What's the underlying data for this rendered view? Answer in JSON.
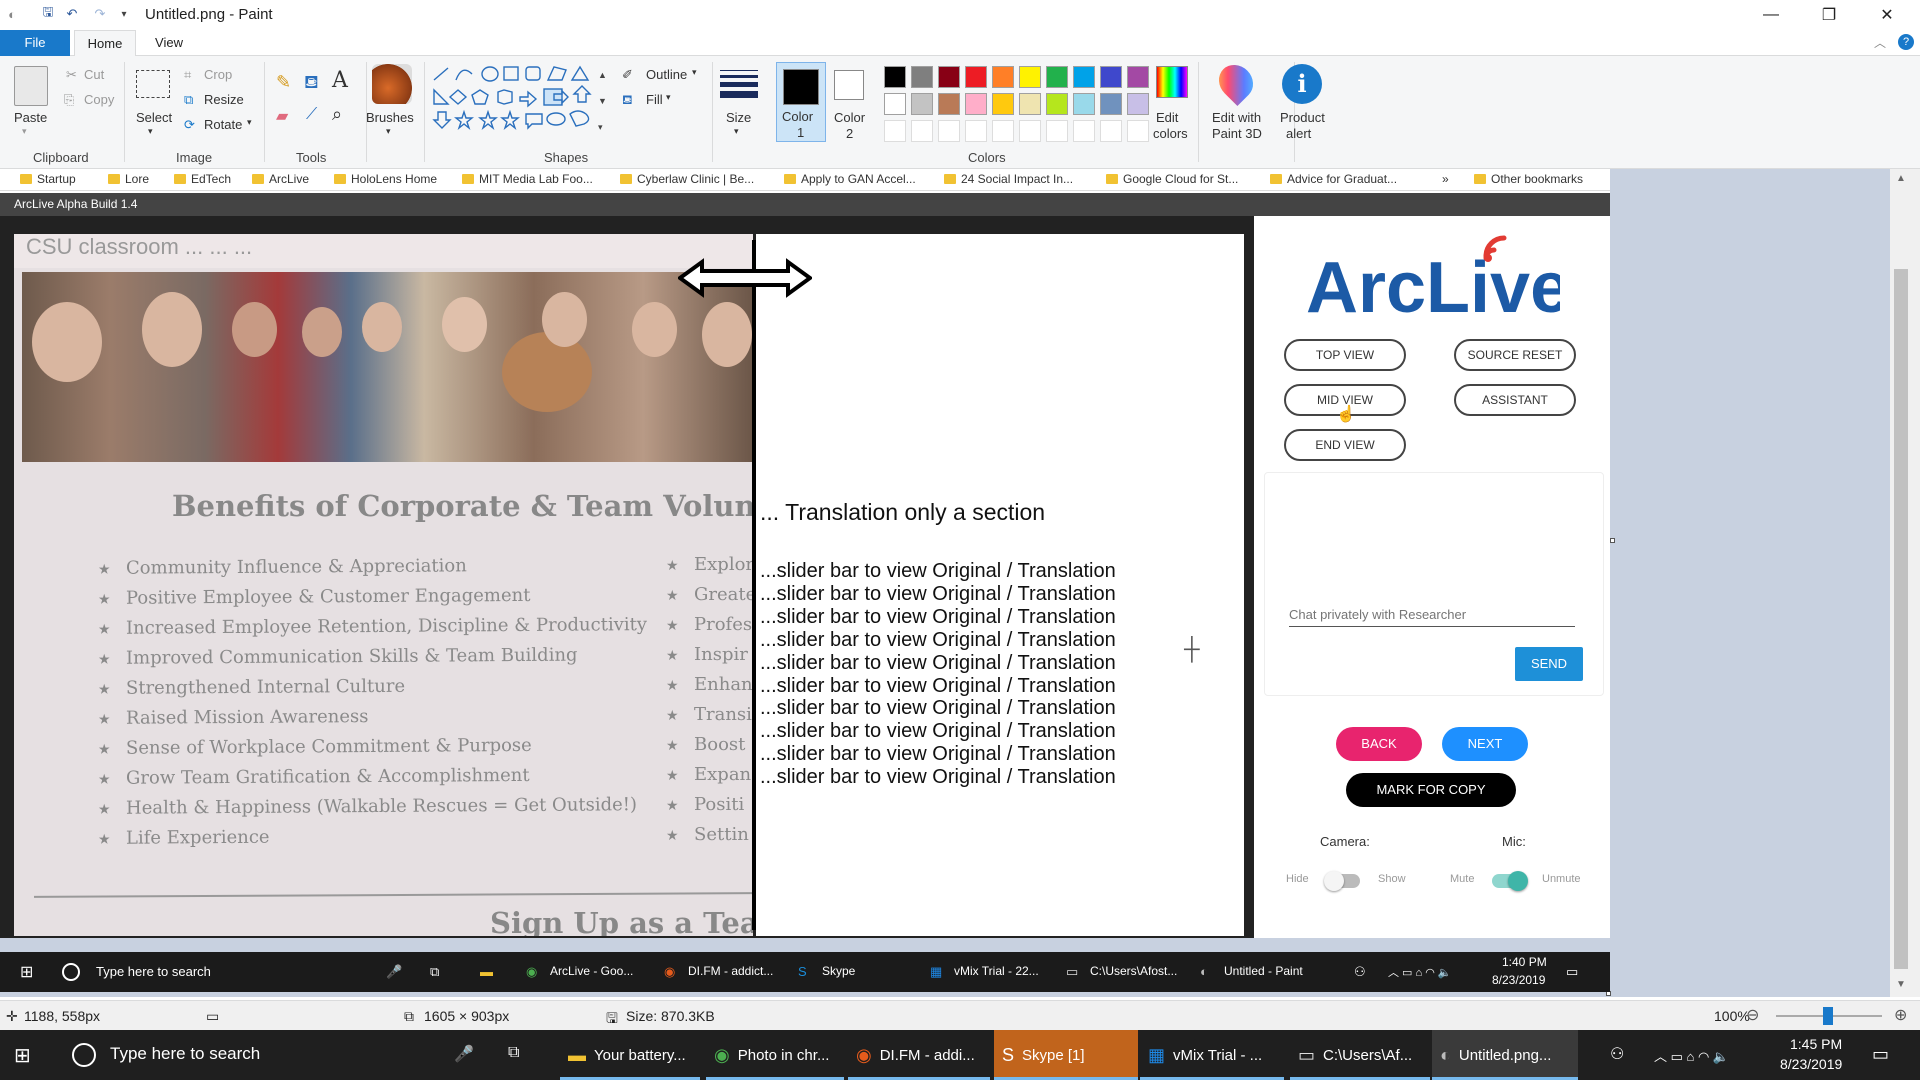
{
  "window": {
    "title": "Untitled.png - Paint"
  },
  "ribbon_tabs": {
    "file": "File",
    "home": "Home",
    "view": "View"
  },
  "ribbon": {
    "clipboard": {
      "paste": "Paste",
      "cut": "Cut",
      "copy": "Copy",
      "label": "Clipboard"
    },
    "image": {
      "select": "Select",
      "crop": "Crop",
      "resize": "Resize",
      "rotate": "Rotate",
      "label": "Image"
    },
    "tools": {
      "label": "Tools"
    },
    "brushes": "Brushes",
    "shapes": {
      "outline": "Outline",
      "fill": "Fill",
      "label": "Shapes"
    },
    "size": "Size",
    "color1": {
      "name": "Color",
      "num": "1"
    },
    "color2": {
      "name": "Color",
      "num": "2"
    },
    "colors_label": "Colors",
    "edit_colors": [
      "Edit",
      "colors"
    ],
    "edit_paint3d": [
      "Edit with",
      "Paint 3D"
    ],
    "product_alert": [
      "Product",
      "alert"
    ],
    "palette_row1": [
      "#000000",
      "#7f7f7f",
      "#880015",
      "#ed1c24",
      "#ff7f27",
      "#fff200",
      "#22b14c",
      "#00a2e8",
      "#3f48cc",
      "#a349a4"
    ],
    "palette_row2": [
      "#ffffff",
      "#c3c3c3",
      "#b97a57",
      "#ffaec9",
      "#ffc90e",
      "#efe4b0",
      "#b5e61d",
      "#99d9ea",
      "#7092be",
      "#c8bfe7"
    ]
  },
  "bookmarks": [
    "Startup",
    "Lore",
    "EdTech",
    "ArcLive",
    "HoloLens Home",
    "MIT Media Lab Foo...",
    "Cyberlaw Clinic | Be...",
    "Apply to GAN Accel...",
    "24 Social Impact In...",
    "Google Cloud for St...",
    "Advice for Graduat...",
    "»",
    "Other bookmarks"
  ],
  "app": {
    "build": "ArcLive Alpha Build 1.4",
    "photo_header": "CSU classroom ... ... ...",
    "benefits_title": "Benefits of Corporate & Team Volun",
    "benefits": [
      "Community Influence & Appreciation",
      "Positive Employee & Customer Engagement",
      "Increased Employee Retention, Discipline & Productivity",
      "Improved Communication Skills & Team Building",
      "Strengthened Internal Culture",
      "Raised Mission Awareness",
      "Sense of Workplace Commitment & Purpose",
      "Grow Team Gratification & Accomplishment",
      "Health & Happiness (Walkable Rescues = Get Outside!)",
      "Life Experience"
    ],
    "right_col": [
      "Explor",
      "Greate",
      "Profes",
      "Inspir",
      "Enhan",
      "Transi",
      "Boost",
      "Expan",
      "Positi",
      "Settin"
    ],
    "signup": "Sign Up as a Tea",
    "translation_heading": "... Translation only a section",
    "translation_rows": [
      "...slider bar to view Original / Translation",
      "...slider bar to view Original / Translation",
      "...slider bar to view Original / Translation",
      "...slider bar to view Original / Translation",
      "...slider bar to view Original / Translation",
      "...slider bar to view Original / Translation",
      "...slider bar to view Original / Translation",
      "...slider bar to view Original / Translation",
      "...slider bar to view Original / Translation",
      "...slider bar to view Original / Translation"
    ],
    "logo_text": "ArcLive",
    "buttons": {
      "top_view": "TOP VIEW",
      "source_reset": "SOURCE RESET",
      "mid_view": "MID VIEW",
      "assistant": "ASSISTANT",
      "end_view": "END VIEW",
      "send": "SEND",
      "back": "BACK",
      "next": "NEXT",
      "mark_for_copy": "MARK FOR COPY"
    },
    "chat_placeholder": "Chat privately with Researcher",
    "camera": {
      "label": "Camera:",
      "hide": "Hide",
      "show": "Show",
      "on": false
    },
    "mic": {
      "label": "Mic:",
      "mute": "Mute",
      "unmute": "Unmute",
      "on": true
    },
    "colors": {
      "back": "#e8246e",
      "next": "#1e90ff",
      "send": "#1e90d8",
      "logo": "#1c5aa6",
      "signal": "#e23b33",
      "toggle_on": "#3fb5a8"
    }
  },
  "inner_taskbar": {
    "search": "Type here to search",
    "apps": [
      "ArcLive - Goo...",
      "DI.FM - addict...",
      "Skype",
      "vMix Trial - 22...",
      "C:\\Users\\Afost...",
      "Untitled - Paint"
    ],
    "time": "1:40 PM",
    "date": "8/23/2019"
  },
  "statusbar": {
    "cursor": "1188, 558px",
    "dimensions": "1605 × 903px",
    "size": "Size: 870.3KB",
    "zoom": "100%"
  },
  "taskbar": {
    "search": "Type here to search",
    "apps": [
      "Your battery...",
      "Photo in chr...",
      "DI.FM - addi...",
      "Skype [1]",
      "vMix Trial - ...",
      "C:\\Users\\Af...",
      "Untitled.png..."
    ],
    "time": "1:45 PM",
    "date": "8/23/2019"
  }
}
